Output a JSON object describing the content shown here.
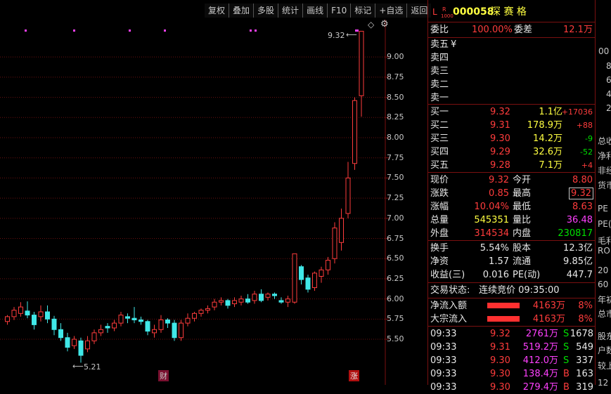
{
  "toolbar": {
    "items": [
      "复权",
      "叠加",
      "多股",
      "统计",
      "画线",
      "F10",
      "标记",
      "+自选",
      "返回"
    ]
  },
  "chart": {
    "y_ticks": [
      "9.00",
      "8.75",
      "8.50",
      "8.25",
      "8.00",
      "7.75",
      "7.50",
      "7.25",
      "7.00",
      "6.75",
      "6.50",
      "6.25",
      "6.00",
      "5.75",
      "5.50"
    ],
    "high_label": "9.32",
    "low_label": "5.21",
    "marker_cai": "财",
    "marker_zhang": "涨",
    "diamond": "◇",
    "gear": "⚙"
  },
  "chart_data": {
    "type": "candlestick",
    "ylim": [
      5.3,
      9.35
    ],
    "candles": [
      [
        5.72,
        5.78,
        5.68,
        5.8
      ],
      [
        5.78,
        5.86,
        5.74,
        5.9
      ],
      [
        5.82,
        5.9,
        5.78,
        5.96
      ],
      [
        5.85,
        5.8,
        5.76,
        5.97
      ],
      [
        5.8,
        5.68,
        5.62,
        5.84
      ],
      [
        5.78,
        5.84,
        5.72,
        5.92
      ],
      [
        5.84,
        5.75,
        5.7,
        5.92
      ],
      [
        5.75,
        5.62,
        5.55,
        5.79
      ],
      [
        5.62,
        5.52,
        5.48,
        5.7
      ],
      [
        5.52,
        5.4,
        5.35,
        5.58
      ],
      [
        5.42,
        5.5,
        5.38,
        5.54
      ],
      [
        5.48,
        5.3,
        5.21,
        5.52
      ],
      [
        5.38,
        5.48,
        5.34,
        5.54
      ],
      [
        5.48,
        5.58,
        5.44,
        5.62
      ],
      [
        5.58,
        5.62,
        5.54,
        5.68
      ],
      [
        5.66,
        5.64,
        5.58,
        5.7
      ],
      [
        5.64,
        5.7,
        5.6,
        5.74
      ],
      [
        5.7,
        5.8,
        5.66,
        5.84
      ],
      [
        5.78,
        5.76,
        5.7,
        5.82
      ],
      [
        5.76,
        5.74,
        5.7,
        5.9
      ],
      [
        5.74,
        5.72,
        5.68,
        5.78
      ],
      [
        5.72,
        5.6,
        5.55,
        5.74
      ],
      [
        5.58,
        5.62,
        5.52,
        5.68
      ],
      [
        5.62,
        5.74,
        5.58,
        5.8
      ],
      [
        5.74,
        5.7,
        5.64,
        5.76
      ],
      [
        5.7,
        5.52,
        5.48,
        5.74
      ],
      [
        5.52,
        5.7,
        5.48,
        5.74
      ],
      [
        5.7,
        5.76,
        5.66,
        5.82
      ],
      [
        5.76,
        5.82,
        5.72,
        5.84
      ],
      [
        5.82,
        5.86,
        5.78,
        5.88
      ],
      [
        5.86,
        5.88,
        5.82,
        5.92
      ],
      [
        5.9,
        5.96,
        5.86,
        6.0
      ],
      [
        5.96,
        5.98,
        5.92,
        6.02
      ],
      [
        5.98,
        5.92,
        5.88,
        6.0
      ],
      [
        5.94,
        5.98,
        5.9,
        6.02
      ],
      [
        5.96,
        6.0,
        5.92,
        6.04
      ],
      [
        6.0,
        5.96,
        5.94,
        6.06
      ],
      [
        5.98,
        6.06,
        5.94,
        6.1
      ],
      [
        6.06,
        5.98,
        5.96,
        6.12
      ],
      [
        6.02,
        6.06,
        5.98,
        6.08
      ],
      [
        6.06,
        6.04,
        6.0,
        6.08
      ],
      [
        5.98,
        5.96,
        5.94,
        6.02
      ],
      [
        5.96,
        6.0,
        5.9,
        6.04
      ],
      [
        5.96,
        6.56,
        5.94,
        6.56
      ],
      [
        6.4,
        6.24,
        6.18,
        6.42
      ],
      [
        6.26,
        6.12,
        6.08,
        6.3
      ],
      [
        6.14,
        6.32,
        6.1,
        6.34
      ],
      [
        6.28,
        6.36,
        6.2,
        6.4
      ],
      [
        6.36,
        6.48,
        6.3,
        6.52
      ],
      [
        6.5,
        6.88,
        6.44,
        6.95
      ],
      [
        6.7,
        7.0,
        6.6,
        7.12
      ],
      [
        7.06,
        7.5,
        7.0,
        7.7
      ],
      [
        7.68,
        8.46,
        7.6,
        8.5
      ],
      [
        8.52,
        9.32,
        8.26,
        9.32
      ]
    ]
  },
  "panel": {
    "market_flag": "L",
    "market_flag_sub": "R",
    "market_flag_num": "1000",
    "code": "000058",
    "name": "深 赛 格",
    "weibi_label": "委比",
    "weibi_value": "100.00%",
    "weicha_label": "委差",
    "weicha_value": "12.1万",
    "sell": [
      {
        "label": "卖五",
        "price": "",
        "vol": "",
        "chg": "",
        "extra": "¥"
      },
      {
        "label": "卖四",
        "price": "",
        "vol": "",
        "chg": ""
      },
      {
        "label": "卖三",
        "price": "",
        "vol": "",
        "chg": ""
      },
      {
        "label": "卖二",
        "price": "",
        "vol": "",
        "chg": ""
      },
      {
        "label": "卖一",
        "price": "",
        "vol": "",
        "chg": ""
      }
    ],
    "buy": [
      {
        "label": "买一",
        "price": "9.32",
        "vol": "1.1亿",
        "chg": "+17036"
      },
      {
        "label": "买二",
        "price": "9.31",
        "vol": "178.9万",
        "chg": "+88"
      },
      {
        "label": "买三",
        "price": "9.30",
        "vol": "14.2万",
        "chg": "-9"
      },
      {
        "label": "买四",
        "price": "9.29",
        "vol": "32.6万",
        "chg": "-52"
      },
      {
        "label": "买五",
        "price": "9.28",
        "vol": "7.1万",
        "chg": "+4"
      }
    ],
    "quote": [
      {
        "l1": "现价",
        "v1": "9.32",
        "l2": "今开",
        "v2": "8.80"
      },
      {
        "l1": "涨跌",
        "v1": "0.85",
        "l2": "最高",
        "v2": "9.32"
      },
      {
        "l1": "涨幅",
        "v1": "10.04%",
        "l2": "最低",
        "v2": "8.63"
      },
      {
        "l1": "总量",
        "v1": "545351",
        "l2": "量比",
        "v2": "36.48"
      },
      {
        "l1": "外盘",
        "v1": "314534",
        "l2": "内盘",
        "v2": "230817"
      }
    ],
    "fund": [
      {
        "l1": "换手",
        "v1": "5.54%",
        "l2": "股本",
        "v2": "12.3亿"
      },
      {
        "l1": "净资",
        "v1": "1.57",
        "l2": "流通",
        "v2": "9.85亿"
      },
      {
        "l1": "收益(三)",
        "v1": "0.016",
        "l2": "PE(动)",
        "v2": "447.7"
      }
    ],
    "status_label": "交易状态:",
    "status_value": "连续竞价 09:35:00",
    "flow": [
      {
        "label": "净流入额",
        "value": "4163万",
        "pct": "8%"
      },
      {
        "label": "大宗流入",
        "value": "4163万",
        "pct": "8%"
      }
    ],
    "ticks": [
      {
        "time": "09:33",
        "price": "9.32",
        "vol": "2761万",
        "side": "S",
        "num": "1678"
      },
      {
        "time": "09:33",
        "price": "9.31",
        "vol": "519.2万",
        "side": "S",
        "num": "549"
      },
      {
        "time": "09:33",
        "price": "9.30",
        "vol": "412.0万",
        "side": "S",
        "num": "337"
      },
      {
        "time": "09:33",
        "price": "9.30",
        "vol": "138.4万",
        "side": "B",
        "num": "163"
      },
      {
        "time": "09:33",
        "price": "9.30",
        "vol": "279.4万",
        "side": "B",
        "num": "319"
      }
    ]
  },
  "far_panel": {
    "top": "00",
    "numbers": [
      "8",
      "6",
      "4",
      "2"
    ],
    "labels": [
      "总收",
      "净利",
      "非经",
      "货币",
      "PE",
      "PE(",
      "毛利",
      "RO",
      "20",
      "60",
      "年初",
      "总市",
      "股东",
      "户数",
      "较上",
      "12"
    ]
  }
}
